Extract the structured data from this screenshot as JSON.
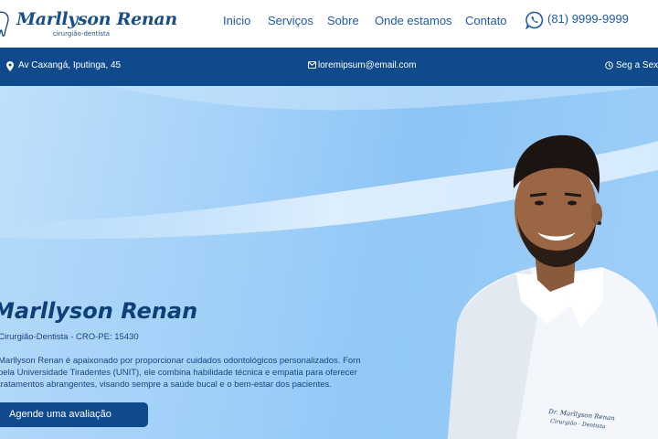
{
  "brand": {
    "name": "Marllyson Renan",
    "subtitle": "cirurgião-dentista"
  },
  "nav": {
    "items": [
      {
        "label": "Inicio"
      },
      {
        "label": "Serviços"
      },
      {
        "label": "Sobre"
      },
      {
        "label": "Onde estamos"
      },
      {
        "label": "Contato"
      }
    ]
  },
  "phone": {
    "number": "(81) 9999-9999",
    "icon": "whatsapp-icon"
  },
  "infobar": {
    "address": "Av Caxangá, Iputinga, 45",
    "email": "loremipsum@email.com",
    "hours": "Seg a Sexta",
    "icons": [
      "location-pin-icon",
      "mail-icon",
      "clock-icon"
    ]
  },
  "hero": {
    "title": "Marllyson Renan",
    "subtitle": "Cirurgião-Dentista - CRO-PE: 15430",
    "description_lines": [
      "Marllyson Renan é apaixonado por proporcionar cuidados odontológicos personalizados. Formado",
      "pela Universidade Tiradentes (UNIT), ele combina habilidade técnica e empatia para oferecer",
      "tratamentos abrangentes, visando sempre a saúde bucal e o bem-estar dos pacientes."
    ],
    "cta_label": "Agende uma avaliação",
    "coat_text": "Dr. Marllyson Renan Cirurgião - Dentista"
  },
  "colors": {
    "brand_blue": "#1d5aa4",
    "dark_blue": "#0f4a8c",
    "hero_light": "#bfe0fb",
    "hero_mid": "#8cc4f6"
  }
}
